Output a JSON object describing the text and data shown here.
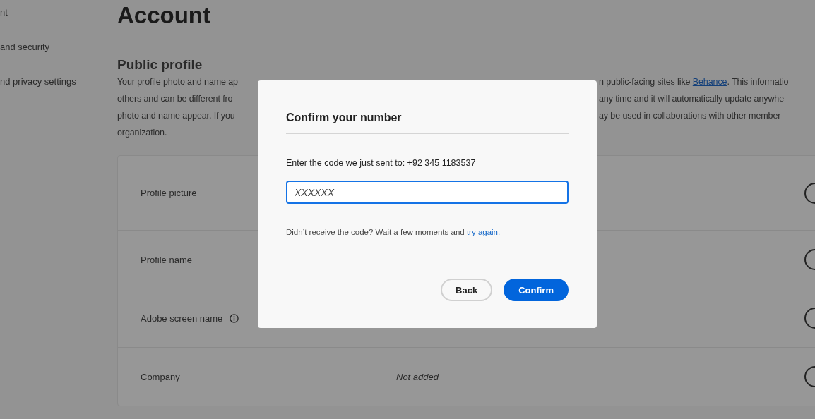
{
  "sidebar": {
    "items": [
      {
        "label": "nt"
      },
      {
        "label": "and security"
      },
      {
        "label": "nd privacy settings"
      }
    ]
  },
  "page": {
    "title": "Account"
  },
  "public_profile": {
    "heading": "Public profile",
    "lines": [
      {
        "left": "Your profile photo and name ap",
        "right": "n public-facing sites like ",
        "link": "Behance",
        "right_after": ". This informatio"
      },
      {
        "left": "others and can be different fro",
        "right": "any time and it will automatically update anywhe"
      },
      {
        "left": "photo and name appear. If you",
        "right": "ay be used in collaborations with other member"
      },
      {
        "left": "organization."
      }
    ]
  },
  "profile_rows": [
    {
      "label": "Profile picture",
      "info": false
    },
    {
      "label": "Profile name",
      "info": false
    },
    {
      "label": "Adobe screen name",
      "info": true
    },
    {
      "label": "Company",
      "info": false,
      "value": "Not added"
    }
  ],
  "dialog": {
    "title": "Confirm your number",
    "message": "Enter the code we just sent to: +92 345 1183537",
    "code_field": {
      "placeholder": "XXXXXX"
    },
    "hint": "Didn’t receive the code? Wait a few moments and ",
    "hint_link": "try again.",
    "buttons": [
      {
        "label": "Back",
        "kind": "secondary"
      },
      {
        "label": "Confirm",
        "kind": "primary"
      }
    ]
  }
}
